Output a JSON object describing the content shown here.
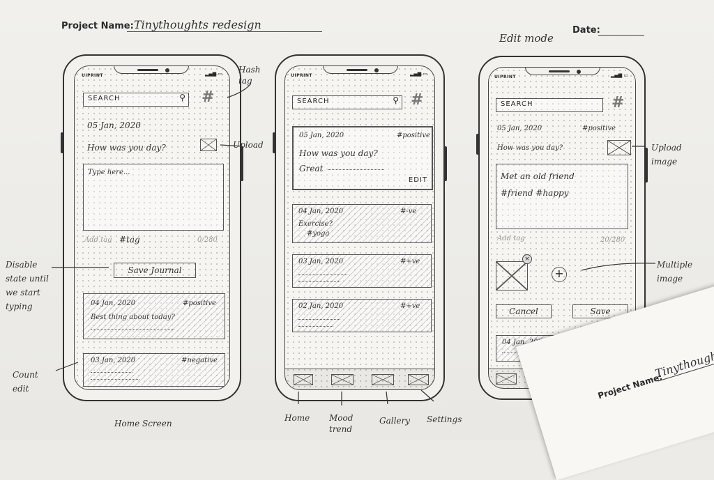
{
  "header": {
    "project_label": "Project Name:",
    "project_value": "Tinythoughts redesign",
    "date_label": "Date:",
    "edit_mode": "Edit mode"
  },
  "brand": "UIPRINT",
  "screen1": {
    "search": "SEARCH",
    "date": "05 Jan, 2020",
    "question": "How was you day?",
    "placeholder": "Type here...",
    "add_tag": "Add tag",
    "tag": "#tag",
    "count": "0/280",
    "save_button": "Save Journal",
    "card1": {
      "date": "04 Jan, 2020",
      "tag": "#positive",
      "text": "Best thing about today?"
    },
    "card2": {
      "date": "03 Jan, 2020",
      "tag": "#negative"
    }
  },
  "screen2": {
    "search": "SEARCH",
    "card1": {
      "date": "05 Jan, 2020",
      "tag": "#positive",
      "question": "How was you day?",
      "answer": "Great",
      "edit": "EDIT"
    },
    "card2": {
      "date": "04 Jan, 2020",
      "tag": "#-ve",
      "question": "Exercise?",
      "tag2": "#yoga"
    },
    "card3": {
      "date": "03 Jan, 2020",
      "tag": "#+ve"
    },
    "card4": {
      "date": "02 Jan, 2020",
      "tag": "#+ve"
    }
  },
  "screen3": {
    "search": "SEARCH",
    "date": "05 Jan, 2020",
    "tag": "#positive",
    "question": "How was you day?",
    "text_line1": "Met an old friend",
    "text_line2": "#friend #happy",
    "add_tag": "Add tag",
    "count": "20/280",
    "cancel": "Cancel",
    "save": "Save",
    "card": {
      "date": "04 Jan, 2020"
    }
  },
  "annotations": {
    "hashtag": "Hash tag",
    "upload": "Upload",
    "disable": "Disable state until we start typing",
    "count_edit": "Count edit",
    "home_screen": "Home Screen",
    "home": "Home",
    "mood_trend": "Mood trend",
    "gallery": "Gallery",
    "settings": "Settings",
    "upload_image": "Upload image",
    "multiple_image": "Multiple image"
  },
  "corner": {
    "label": "Project Name:",
    "value": "Tinythoughts"
  }
}
